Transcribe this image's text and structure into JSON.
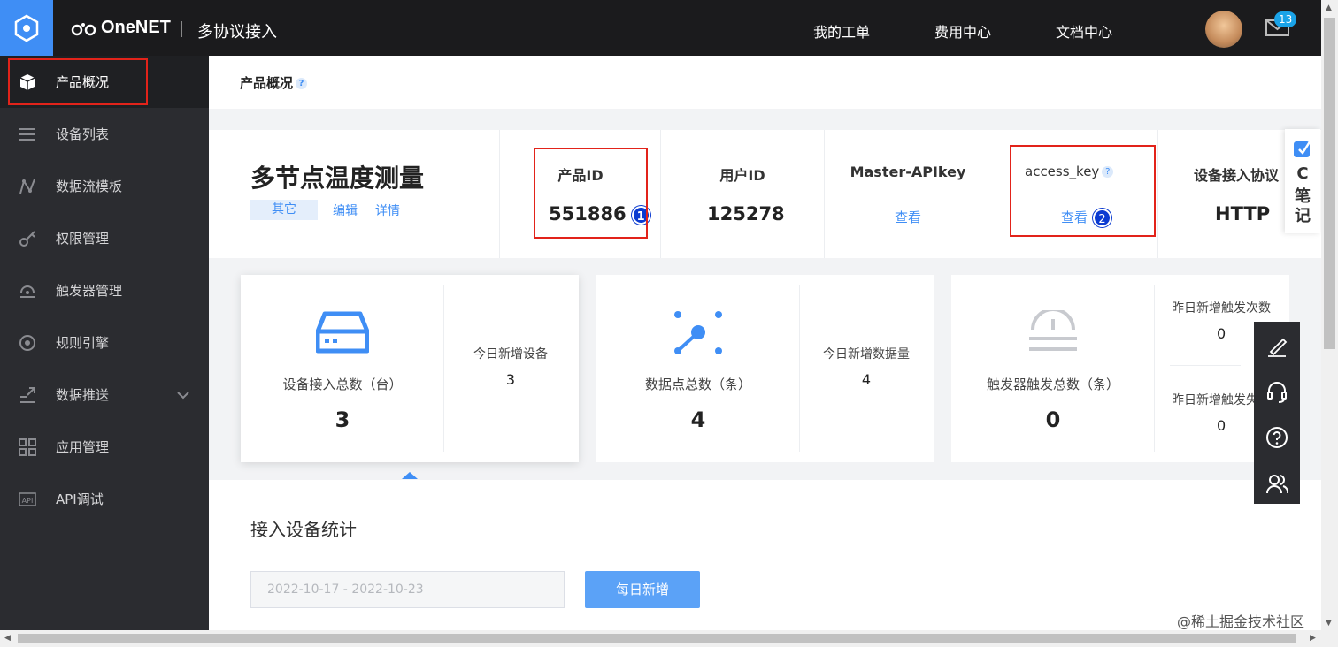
{
  "header": {
    "brand": "OneNET",
    "subtitle": "多协议接入",
    "nav": [
      "我的工单",
      "费用中心",
      "文档中心"
    ],
    "mail_count": "13"
  },
  "sidebar": {
    "items": [
      {
        "label": "产品概况",
        "icon": "cube-icon"
      },
      {
        "label": "设备列表",
        "icon": "list-icon"
      },
      {
        "label": "数据流模板",
        "icon": "stream-icon"
      },
      {
        "label": "权限管理",
        "icon": "key-icon"
      },
      {
        "label": "触发器管理",
        "icon": "trigger-icon"
      },
      {
        "label": "规则引擎",
        "icon": "rule-icon"
      },
      {
        "label": "数据推送",
        "icon": "push-icon"
      },
      {
        "label": "应用管理",
        "icon": "grid-icon"
      },
      {
        "label": "API调试",
        "icon": "api-icon"
      }
    ]
  },
  "page": {
    "title": "产品概况",
    "help": "?"
  },
  "product": {
    "name": "多节点温度测量",
    "tag": "其它",
    "edit": "编辑",
    "detail": "详情",
    "product_id_label": "产品ID",
    "product_id": "551886",
    "user_id_label": "用户ID",
    "user_id": "125278",
    "master_key_label": "Master-APIkey",
    "master_key_link": "查看",
    "access_key_label": "access_key",
    "access_key_link": "查看",
    "protocol_label": "设备接入协议",
    "protocol": "HTTP",
    "marker1": "1",
    "marker2": "2"
  },
  "stats": {
    "devices": {
      "label": "设备接入总数（台）",
      "value": "3",
      "today_label": "今日新增设备",
      "today_value": "3"
    },
    "datapoints": {
      "label": "数据点总数（条）",
      "value": "4",
      "today_label": "今日新增数据量",
      "today_value": "4"
    },
    "triggers": {
      "label": "触发器触发总数（条）",
      "value": "0",
      "yesterday_label": "昨日新增触发次数",
      "yesterday_value": "0",
      "yesterday2_label": "昨日新增触发失",
      "yesterday2_value": "0"
    }
  },
  "lower": {
    "section_title": "接入设备统计",
    "date_range": "2022-10-17 - 2022-10-23",
    "daily_button": "每日新增"
  },
  "cnote": {
    "c": "C",
    "l1": "笔",
    "l2": "记"
  },
  "watermark": "@稀土掘金技术社区"
}
